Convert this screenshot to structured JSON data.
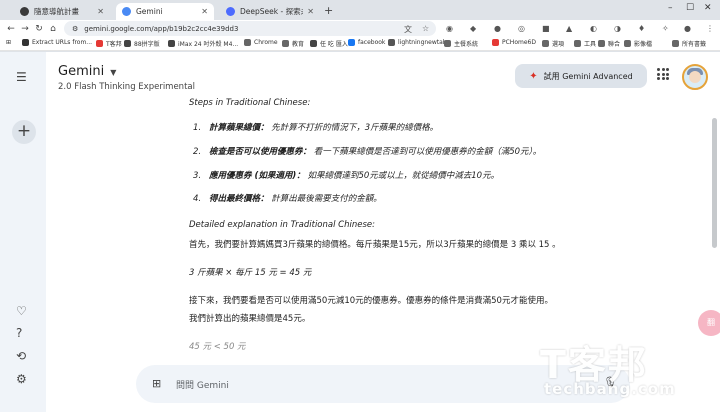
{
  "browser": {
    "tabs": [
      {
        "title": "隨意導航計畫",
        "active": false
      },
      {
        "title": "Gemini",
        "active": true
      },
      {
        "title": "DeepSeek - 探索未至之境",
        "active": false
      }
    ],
    "url": "gemini.google.com/app/b19b2c2cc4e39dd3",
    "bookmarks": [
      "Extract URLs from...",
      "T客邦",
      "88拼字版",
      "iMax 24 吋外殼 M4...",
      "Chrome",
      "教育",
      "任 吃 匯入",
      "facebook",
      "lightningnewtab",
      "主餐系統",
      "PCHome6D",
      "選項",
      "工具",
      "聯合",
      "影像檔",
      "所有書籤"
    ]
  },
  "app": {
    "brand": "Gemini",
    "model": "2.0 Flash Thinking Experimental",
    "advanced_button": "試用 Gemini Advanced",
    "input_placeholder": "問問 Gemini"
  },
  "response": {
    "steps_heading": "Steps in Traditional Chinese:",
    "steps": [
      {
        "num": "1.",
        "bold": "計算蘋果總價：",
        "text": "先計算不打折的情況下，3斤蘋果的總價格。"
      },
      {
        "num": "2.",
        "bold": "檢查是否可以使用優惠券：",
        "text": "看一下蘋果總價是否達到可以使用優惠券的金額（滿50元）。"
      },
      {
        "num": "3.",
        "bold": "應用優惠券 (如果適用)：",
        "text": "如果總價達到50元或以上，就從總價中減去10元。"
      },
      {
        "num": "4.",
        "bold": "得出最終價格：",
        "text": "計算出最後需要支付的金額。"
      }
    ],
    "explanation_heading": "Detailed explanation in Traditional Chinese:",
    "para1": "首先，我們要計算媽媽買3斤蘋果的總價格。每斤蘋果是15元，所以3斤蘋果的總價是 3 乘以 15 。",
    "formula": "3 斤蘋果 × 每斤 15 元 = 45 元",
    "para2_line1": "接下來，我們要看是否可以使用滿50元減10元的優惠券。優惠券的條件是消費滿50元才能使用。",
    "para2_line2": "我們計算出的蘋果總價是45元。",
    "faded_line": "45 元 < 50 元"
  },
  "watermark": {
    "main": "T客邦",
    "sub": "techbang.com"
  },
  "float_button": "翻"
}
